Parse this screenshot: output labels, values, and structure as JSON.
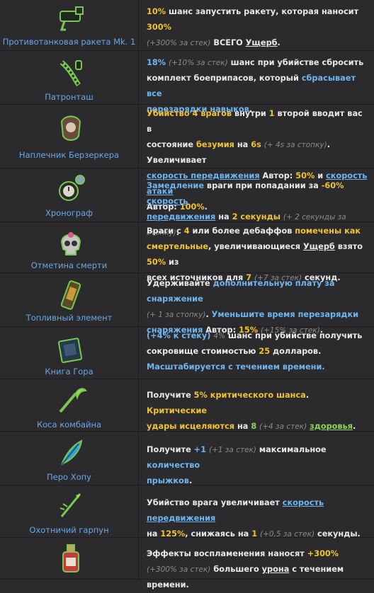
{
  "colors": {
    "background": "#2b2b2d",
    "name": "#6aa6e8",
    "yellow": "#f1c232",
    "blue": "#6fb6f0",
    "gray": "#8a8a8a",
    "green": "#8fd25a"
  },
  "items": [
    {
      "name": "Противотанковая ракета Mk. 1",
      "icon": "rocket-launcher-icon",
      "d": [
        [
          "y",
          "10%"
        ],
        [
          "t",
          " шанс запустить ракету, которая наносит "
        ],
        [
          "y",
          "300%"
        ],
        [
          "br",
          ""
        ],
        [
          "g",
          "(+300% за стек)"
        ],
        [
          "t",
          " ВСЕГО "
        ],
        [
          "u",
          "Ущерб"
        ],
        [
          "t",
          "."
        ]
      ]
    },
    {
      "name": "Патронташ",
      "icon": "bandolier-icon",
      "d": [
        [
          "b",
          "18%"
        ],
        [
          "t",
          " "
        ],
        [
          "g",
          "(+10% за стек)"
        ],
        [
          "t",
          " шанс при убийстве сбросить"
        ],
        [
          "br",
          ""
        ],
        [
          "t",
          "комплект боеприпасов, который "
        ],
        [
          "b",
          "сбрасывает все"
        ],
        [
          "br",
          ""
        ],
        [
          "b",
          "перезарядки навыков"
        ],
        [
          "t",
          "."
        ]
      ]
    },
    {
      "name": "Наплечник Берзеркера",
      "icon": "pauldron-icon",
      "d": [
        [
          "y",
          "Убийство "
        ],
        [
          "y",
          "4"
        ],
        [
          "y",
          " врагов"
        ],
        [
          "t",
          " внутри "
        ],
        [
          "y",
          "1"
        ],
        [
          "t",
          " второй вводит вас в"
        ],
        [
          "br",
          ""
        ],
        [
          "t",
          "состояние "
        ],
        [
          "y",
          "безумия"
        ],
        [
          "t",
          " на "
        ],
        [
          "y",
          "6s"
        ],
        [
          "t",
          " "
        ],
        [
          "g",
          "(+ 4s за стопку)"
        ],
        [
          "t",
          ". Увеличивает"
        ],
        [
          "br",
          ""
        ],
        [
          "bu",
          "скорость передвижения"
        ],
        [
          "t",
          " Автор: "
        ],
        [
          "y",
          "50%"
        ],
        [
          "t",
          " и "
        ],
        [
          "bu",
          "скорость атаки"
        ],
        [
          "br",
          ""
        ],
        [
          "t",
          "Автор: "
        ],
        [
          "y",
          "100%"
        ],
        [
          "t",
          "."
        ]
      ]
    },
    {
      "name": "Хронограф",
      "icon": "stopwatch-icon",
      "d": [
        [
          "b",
          "Замедление"
        ],
        [
          "t",
          " враги при попадании за "
        ],
        [
          "y",
          "-60%"
        ],
        [
          "t",
          " "
        ],
        [
          "bu",
          "скорость"
        ],
        [
          "br",
          ""
        ],
        [
          "bu",
          "передвижения"
        ],
        [
          "t",
          " на "
        ],
        [
          "y",
          "2 секунды"
        ],
        [
          "t",
          " "
        ],
        [
          "g",
          "(+ 2 секунды за стопку)"
        ],
        [
          "t",
          "."
        ]
      ]
    },
    {
      "name": "Отметина смерти",
      "icon": "skull-icon",
      "d": [
        [
          "t",
          "Враги с "
        ],
        [
          "y",
          "4"
        ],
        [
          "t",
          " или более дебаффов "
        ],
        [
          "y",
          "помечены как"
        ],
        [
          "br",
          ""
        ],
        [
          "y",
          "смертельные"
        ],
        [
          "t",
          ", увеличивающиеся "
        ],
        [
          "u",
          "Ущерб"
        ],
        [
          "t",
          " взято "
        ],
        [
          "y",
          "50%"
        ],
        [
          "t",
          " из"
        ],
        [
          "br",
          ""
        ],
        [
          "t",
          "всех источников для "
        ],
        [
          "y",
          "7"
        ],
        [
          "t",
          " "
        ],
        [
          "g",
          "(+7 за стек)"
        ],
        [
          "t",
          " секунд."
        ]
      ]
    },
    {
      "name": "Топливный элемент",
      "icon": "fuel-cell-icon",
      "d": [
        [
          "t",
          "Удерживайте "
        ],
        [
          "b",
          "дополнительную плату за снаряжение"
        ],
        [
          "br",
          ""
        ],
        [
          "g",
          "(+ 1 за стопку)"
        ],
        [
          "t",
          ". "
        ],
        [
          "b",
          "Уменьшите время перезарядки"
        ],
        [
          "br",
          ""
        ],
        [
          "b",
          "снаряжения"
        ],
        [
          "t",
          " Автор: "
        ],
        [
          "y",
          "15%"
        ],
        [
          "t",
          " "
        ],
        [
          "g",
          "(+15% за стек)"
        ],
        [
          "t",
          "."
        ]
      ]
    },
    {
      "name": "Книга Гора",
      "icon": "book-icon",
      "d": [
        [
          "b",
          "(+4% к стеку)"
        ],
        [
          "t",
          " "
        ],
        [
          "g",
          "4%"
        ],
        [
          "t",
          " шанс при убийстве получить"
        ],
        [
          "br",
          ""
        ],
        [
          "t",
          "сокровище стоимостью "
        ],
        [
          "y",
          "25"
        ],
        [
          "t",
          " долларов."
        ],
        [
          "br",
          ""
        ],
        [
          "b",
          "Масштабируется с течением времени."
        ]
      ]
    },
    {
      "name": "Коса комбайна",
      "icon": "scythe-icon",
      "d": [
        [
          "t",
          "Получите "
        ],
        [
          "y",
          "5% критического шанса"
        ],
        [
          "t",
          ". "
        ],
        [
          "y",
          "Критические"
        ],
        [
          "br",
          ""
        ],
        [
          "y",
          "удары"
        ],
        [
          "t",
          " "
        ],
        [
          "y",
          "исцеляются"
        ],
        [
          "t",
          " на "
        ],
        [
          "n",
          "8"
        ],
        [
          "t",
          " "
        ],
        [
          "g",
          "(+4 за стек)"
        ],
        [
          "t",
          " "
        ],
        [
          "gu",
          "здоровья"
        ],
        [
          "t",
          "."
        ]
      ]
    },
    {
      "name": "Перо Хопу",
      "icon": "feather-icon",
      "d": [
        [
          "t",
          "Получите "
        ],
        [
          "b",
          "+1"
        ],
        [
          "t",
          " "
        ],
        [
          "g",
          "(+1 за стек)"
        ],
        [
          "t",
          " максимальное "
        ],
        [
          "b",
          "количество"
        ],
        [
          "br",
          ""
        ],
        [
          "b",
          "прыжков"
        ],
        [
          "t",
          "."
        ]
      ]
    },
    {
      "name": "Охотничий гарпун",
      "icon": "harpoon-icon",
      "d": [
        [
          "t",
          "Убийство врага увеличивает "
        ],
        [
          "bu",
          "скорость передвижения"
        ],
        [
          "br",
          ""
        ],
        [
          "t",
          "на "
        ],
        [
          "y",
          "125%"
        ],
        [
          "t",
          ", снижаясь на "
        ],
        [
          "y",
          "1"
        ],
        [
          "t",
          " "
        ],
        [
          "g",
          "(+0,5 за стек)"
        ],
        [
          "t",
          " секунды."
        ]
      ]
    },
    {
      "name": "",
      "icon": "bottle-icon",
      "d": [
        [
          "t",
          "Эффекты воспламенения наносят "
        ],
        [
          "y",
          "+300%"
        ],
        [
          "br",
          ""
        ],
        [
          "g",
          "(+300% за стек)"
        ],
        [
          "t",
          " большего "
        ],
        [
          "u",
          "урона"
        ],
        [
          "t",
          " с течением времени."
        ]
      ]
    }
  ]
}
